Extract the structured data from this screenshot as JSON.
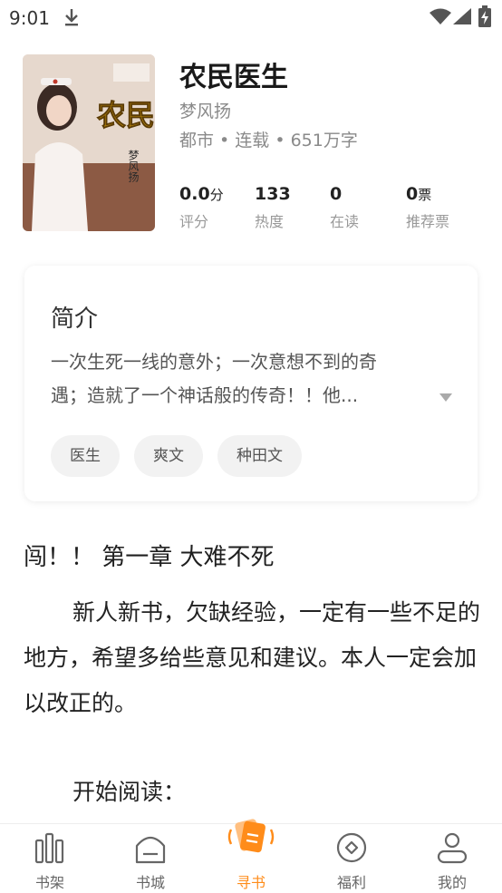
{
  "status_bar": {
    "time": "9:01",
    "icons": [
      "download-icon",
      "wifi-icon",
      "signal-icon",
      "battery-charging-icon"
    ]
  },
  "book": {
    "title": "农民医生",
    "author": "梦风扬",
    "meta": "都市 • 连载 • 651万字",
    "cover_text": {
      "title": "农民医生",
      "author": "梦风扬"
    },
    "stats": [
      {
        "value": "0.0",
        "unit": "分",
        "label": "评分"
      },
      {
        "value": "133",
        "unit": "",
        "label": "热度"
      },
      {
        "value": "0",
        "unit": "",
        "label": "在读"
      },
      {
        "value": "0",
        "unit": "票",
        "label": "推荐票"
      }
    ]
  },
  "intro": {
    "heading": "简介",
    "text_line1": "一次生死一线的意外；一次意想不到的奇",
    "text_line2": "遇；造就了一个神话般的传奇！！他...",
    "tags": [
      "医生",
      "爽文",
      "种田文"
    ]
  },
  "chapter": {
    "title": "闯！！ 第一章  大难不死",
    "body": "新人新书，欠缺经验，一定有一些不足的地方，希望多给些意见和建议。本人一定会加以改正的。",
    "start": "开始阅读："
  },
  "bottom_nav": {
    "items": [
      {
        "label": "书架",
        "icon": "bookshelf-icon",
        "active": false
      },
      {
        "label": "书城",
        "icon": "bookstore-icon",
        "active": false
      },
      {
        "label": "寻书",
        "icon": "find-book-icon",
        "active": true
      },
      {
        "label": "福利",
        "icon": "benefits-icon",
        "active": false
      },
      {
        "label": "我的",
        "icon": "profile-icon",
        "active": false
      }
    ]
  },
  "colors": {
    "accent": "#ff8c1a",
    "text_primary": "#222222",
    "text_secondary": "#8a8a8a",
    "tag_bg": "#f2f2f2"
  }
}
